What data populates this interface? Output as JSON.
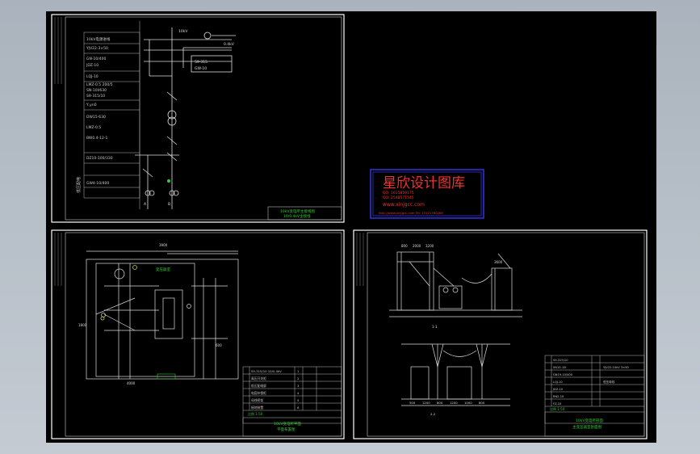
{
  "sheets": {
    "top_left": {
      "title_block": [
        "10kV变电所主接线图",
        "10/0.4kV主接线"
      ],
      "table_rows": [
        "10kV电源进线",
        "YJV22-3×50",
        "GN-10/400",
        "JDZ-10",
        "LQJ-10",
        "LMZ-0.5 200/5",
        "SN-10I/630",
        "S9-315/10",
        "Y,yn0",
        "DW15-630",
        "LMZ-0.5",
        "BW0.4-12-1",
        "DZ10-100/330",
        "GW4-10/400"
      ],
      "section_labels": [
        "低压配电"
      ],
      "annotations": [
        "10kV",
        "0.4kV",
        "S9-315",
        "GW-10",
        "A",
        "B"
      ]
    },
    "watermark": {
      "title": "星欣设计图库",
      "qq_line1": "QQ: 1615859175",
      "qq_line2": "QQ: 2548571545",
      "site": "www.xinjgcc.com",
      "footer": "http://www.xinjgcc.com   Tel: 13101760289"
    },
    "bottom_left": {
      "dims": [
        "3900",
        "1800",
        "600",
        "4000"
      ],
      "label_green": "变压器室",
      "title_block": [
        "10kV变电所平面",
        "平面布置图"
      ],
      "table_rows": [
        "S9-315/10 10/0.4kV",
        "高压开关柜",
        "低压配电屏",
        "电容补偿柜",
        "母线桥架",
        "接地装置"
      ],
      "table_nums": [
        "1",
        "2",
        "3",
        "4",
        "5",
        "6"
      ],
      "scale": "比例 1:50"
    },
    "bottom_right": {
      "section_labels": [
        "1-1",
        "2-2"
      ],
      "dims_top": [
        "800",
        "2000",
        "3200",
        "3600"
      ],
      "dims_bottom": [
        "500",
        "1200",
        "800",
        "1200",
        "1000",
        "800"
      ],
      "title_block": [
        "10kV变电所剖面",
        "主变压器室剖面图"
      ],
      "table_rows": [
        "S9-315/10",
        "SN10-10I",
        "GN19-10/400",
        "LQJ-10",
        "JDZ-10",
        "RN2-10",
        "FZ-10",
        "YJV22-10kV 3×50",
        "低压母线"
      ],
      "scale": "比例 1:50"
    }
  }
}
